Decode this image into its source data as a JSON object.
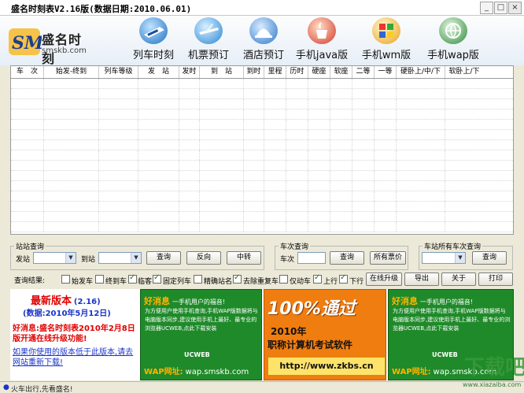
{
  "window": {
    "title": "盛名时刻表V2.16版(数据日期:2010.06.01)",
    "min_label": "_",
    "max_label": "□",
    "close_label": "×"
  },
  "logo": {
    "mark": "SM",
    "name": "盛名时刻",
    "domain": "smskb.com"
  },
  "nav": [
    {
      "label": "列车时刻",
      "icon": "train-icon"
    },
    {
      "label": "机票预订",
      "icon": "airplane-icon"
    },
    {
      "label": "酒店预订",
      "icon": "hotel-bell-icon"
    },
    {
      "label": "手机java版",
      "icon": "java-cup-icon"
    },
    {
      "label": "手机wm版",
      "icon": "windows-logo-icon"
    },
    {
      "label": "手机wap版",
      "icon": "wap-globe-icon"
    }
  ],
  "table": {
    "columns": [
      "车　次",
      "始发-终到",
      "列车等级",
      "发　站",
      "发时",
      "到　站",
      "到时",
      "里程",
      "历时",
      "硬座",
      "软座",
      "二等",
      "一等",
      "硬卧上/中/下",
      "软卧上/下"
    ]
  },
  "station_query": {
    "legend": "站站查询",
    "from_label": "发站",
    "to_label": "到站",
    "query_btn": "查询",
    "reverse_btn": "反向",
    "transfer_btn": "中转"
  },
  "train_query": {
    "legend": "车次查询",
    "train_label": "车次",
    "query_btn": "查询",
    "price_btn": "所有票价"
  },
  "all_trains_query": {
    "legend": "车站所有车次查询",
    "query_btn": "查询"
  },
  "filters": {
    "label": "查询结果:",
    "items": [
      {
        "label": "始发车",
        "checked": false
      },
      {
        "label": "终到车",
        "checked": false
      },
      {
        "label": "临客",
        "checked": true
      },
      {
        "label": "固定列车",
        "checked": true
      },
      {
        "label": "精确站名",
        "checked": false
      },
      {
        "label": "去除重复车",
        "checked": true
      },
      {
        "label": "仅动车",
        "checked": false
      },
      {
        "label": "上行",
        "checked": true
      },
      {
        "label": "下行",
        "checked": true
      }
    ],
    "online_upgrade_btn": "在线升级",
    "export_btn": "导出",
    "about_btn": "关于",
    "print_btn": "打印"
  },
  "ad_left": {
    "headline": "最新版本",
    "version": "(2.16)",
    "data_date": "(数据:2010年5月12日)",
    "news": "好消息:盛名时刻表2010年2月8日版开通在线升级功能!",
    "link": "如果你使用的版本低于此版本,请去网站重新下载!"
  },
  "ad_mobile": {
    "tag": "好消息",
    "headline": "一手机用户的福音!",
    "body": "为方便用户使用手机查询,手机WAP版数据将与电脑版本同步,建议使用手机上最好、最专业的浏览器UCWEB,点此下载安装",
    "brand": "UCWEB",
    "wap_label": "WAP网址:",
    "wap_url": "wap.smskb.com"
  },
  "ad_exam": {
    "headline": "100%通过",
    "year": "2010年",
    "subject": "职称计算机考试软件",
    "url": "http://www.zkbs.cn"
  },
  "status": {
    "text": "火车出行,先看盛名!"
  },
  "watermark": {
    "text": "下载吧",
    "url": "www.xiazaiba.com"
  },
  "colors": {
    "window_bg": "#ece9d8",
    "banner_bg": "#eef3fa",
    "ad_green": "#1f8a2a",
    "ad_orange": "#f07d10",
    "headline_red": "#e00000",
    "link_blue": "#1a33c8"
  }
}
